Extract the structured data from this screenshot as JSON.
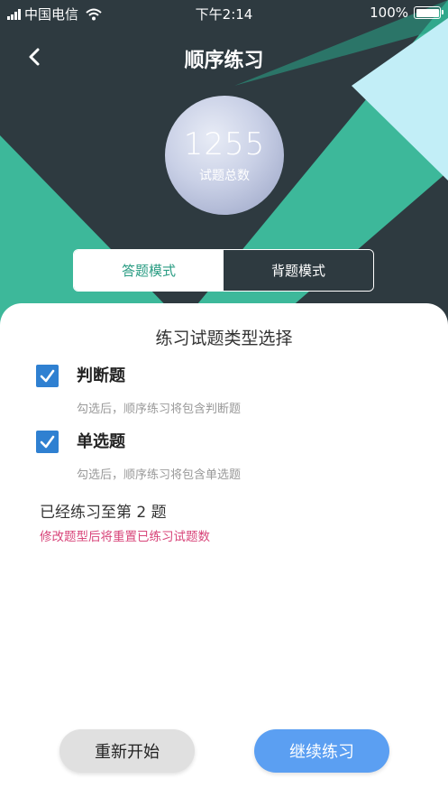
{
  "status_bar": {
    "carrier": "中国电信",
    "time": "下午2:14",
    "battery": "100%",
    "battery_level": 1.0
  },
  "nav": {
    "title": "顺序练习"
  },
  "summary": {
    "total_count": "1255",
    "total_label": "试题总数"
  },
  "mode_tabs": [
    {
      "label": "答题模式",
      "active": true
    },
    {
      "label": "背题模式",
      "active": false
    }
  ],
  "panel": {
    "title": "练习试题类型选择",
    "options": [
      {
        "label": "判断题",
        "checked": true,
        "description": "勾选后，顺序练习将包含判断题"
      },
      {
        "label": "单选题",
        "checked": true,
        "description": "勾选后，顺序练习将包含单选题"
      }
    ],
    "progress_text": "已经练习至第 2 题",
    "warning_text": "修改题型后将重置已练习试题数"
  },
  "buttons": {
    "restart": "重新开始",
    "continue": "继续练习"
  },
  "colors": {
    "header_dark": "#2e3a40",
    "teal": "#3db89a",
    "light_cyan": "#c2eef7",
    "checkbox_blue": "#2f80d1",
    "continue_blue": "#5b9ff2",
    "warning_pink": "#d8457a",
    "active_tab_text": "#2a9c83"
  },
  "icons": {
    "back": "chevron-left-icon",
    "wifi": "wifi-icon",
    "signal": "signal-icon",
    "battery": "battery-icon",
    "check": "check-icon"
  }
}
